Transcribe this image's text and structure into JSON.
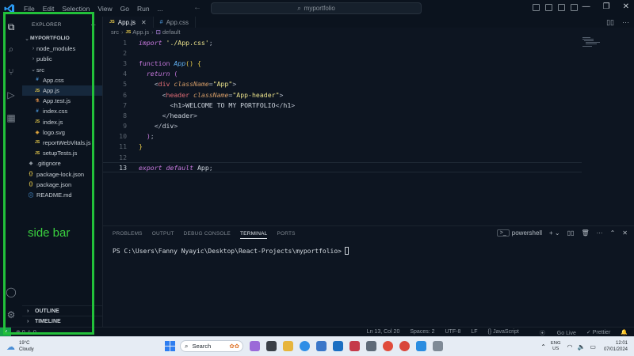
{
  "titlebar": {
    "menu": [
      "File",
      "Edit",
      "Selection",
      "View",
      "Go",
      "Run",
      "..."
    ],
    "search_text": "myportfolio"
  },
  "sidebar": {
    "title": "EXPLORER",
    "more": "...",
    "root": "MYPORTFOLIO",
    "items": [
      {
        "label": "node_modules",
        "kind": "folder",
        "icon_text": ""
      },
      {
        "label": "public",
        "kind": "folder",
        "icon_text": ""
      },
      {
        "label": "src",
        "kind": "folder-open",
        "icon_text": ""
      },
      {
        "label": "App.css",
        "kind": "css",
        "icon_text": "#"
      },
      {
        "label": "App.js",
        "kind": "js",
        "icon_text": "JS"
      },
      {
        "label": "App.test.js",
        "kind": "test",
        "icon_text": "⚗"
      },
      {
        "label": "index.css",
        "kind": "css",
        "icon_text": "#"
      },
      {
        "label": "index.js",
        "kind": "js",
        "icon_text": "JS"
      },
      {
        "label": "logo.svg",
        "kind": "svg",
        "icon_text": "◈"
      },
      {
        "label": "reportWebVitals.js",
        "kind": "js",
        "icon_text": "JS"
      },
      {
        "label": "setupTests.js",
        "kind": "js",
        "icon_text": "JS"
      },
      {
        "label": ".gitignore",
        "kind": "git",
        "icon_text": "◆"
      },
      {
        "label": "package-lock.json",
        "kind": "json",
        "icon_text": "{}"
      },
      {
        "label": "package.json",
        "kind": "json",
        "icon_text": "{}"
      },
      {
        "label": "README.md",
        "kind": "info",
        "icon_text": "ⓘ"
      }
    ],
    "outline": "OUTLINE",
    "timeline": "TIMELINE"
  },
  "annotation": {
    "label": "side bar",
    "color": "#22c03a"
  },
  "tabs": [
    {
      "label": "App.js",
      "badge": "JS",
      "active": true
    },
    {
      "label": "App.css",
      "badge": "#",
      "active": false
    }
  ],
  "breadcrumb": {
    "folder": "src",
    "file": "App.js",
    "symbol": "default"
  },
  "code": {
    "current_line": 13,
    "lines": [
      {
        "n": "1"
      },
      {
        "n": "2"
      },
      {
        "n": "3"
      },
      {
        "n": "4"
      },
      {
        "n": "5"
      },
      {
        "n": "6"
      },
      {
        "n": "7"
      },
      {
        "n": "8"
      },
      {
        "n": "9"
      },
      {
        "n": "10"
      },
      {
        "n": "11"
      },
      {
        "n": "12"
      },
      {
        "n": "13"
      }
    ],
    "l1": {
      "kw": "import",
      "str": "'./App.css'",
      "end": ";"
    },
    "l3": {
      "kw": "function",
      "name": "App",
      "paren": "() {"
    },
    "l4": {
      "kw": "return",
      "paren": "("
    },
    "l5": {
      "open": "<",
      "tag": "div",
      "attr": "className",
      "eq": "=",
      "str": "\"App\"",
      "close": ">"
    },
    "l6": {
      "open": "<",
      "tag": "header",
      "attr": "className",
      "eq": "=",
      "str": "\"App-header\"",
      "close": ">"
    },
    "l7": {
      "open": "<",
      "tag": "h1",
      "close": ">",
      "text": "WELCOME TO MY PORTFOLIO",
      "endopen": "</",
      "endtag": "h1",
      "endclose": ">"
    },
    "l8": {
      "open": "</",
      "tag": "header",
      "close": ">"
    },
    "l9": {
      "open": "</",
      "tag": "div",
      "close": ">"
    },
    "l10": {
      "paren": ")",
      "end": ";"
    },
    "l11": {
      "paren": "}"
    },
    "l13": {
      "kw": "export",
      "kw2": "default",
      "name": "App",
      "end": ";"
    }
  },
  "panel": {
    "tabs": [
      "PROBLEMS",
      "OUTPUT",
      "DEBUG CONSOLE",
      "TERMINAL",
      "PORTS"
    ],
    "active_tab": "TERMINAL",
    "shell": "powershell",
    "prompt": "PS C:\\Users\\Fanny Nyayic\\Desktop\\React-Projects\\myportfolio>"
  },
  "statusbar": {
    "left": "⊗ 0 ⚠ 0",
    "position": "Ln 13, Col 20",
    "spaces": "Spaces: 2",
    "encoding": "UTF-8",
    "eol": "LF",
    "language": "{} JavaScript",
    "golive": "Go Live",
    "prettier": "✓ Prettier"
  },
  "taskbar": {
    "temperature": "19°C",
    "weather": "Cloudy",
    "search": "Search",
    "lang_top": "ENG",
    "lang_bottom": "US",
    "time": "12:01",
    "date": "07/01/2024"
  },
  "colors": {
    "accent_green": "#22c03a",
    "status_remote": "#17a34a"
  }
}
